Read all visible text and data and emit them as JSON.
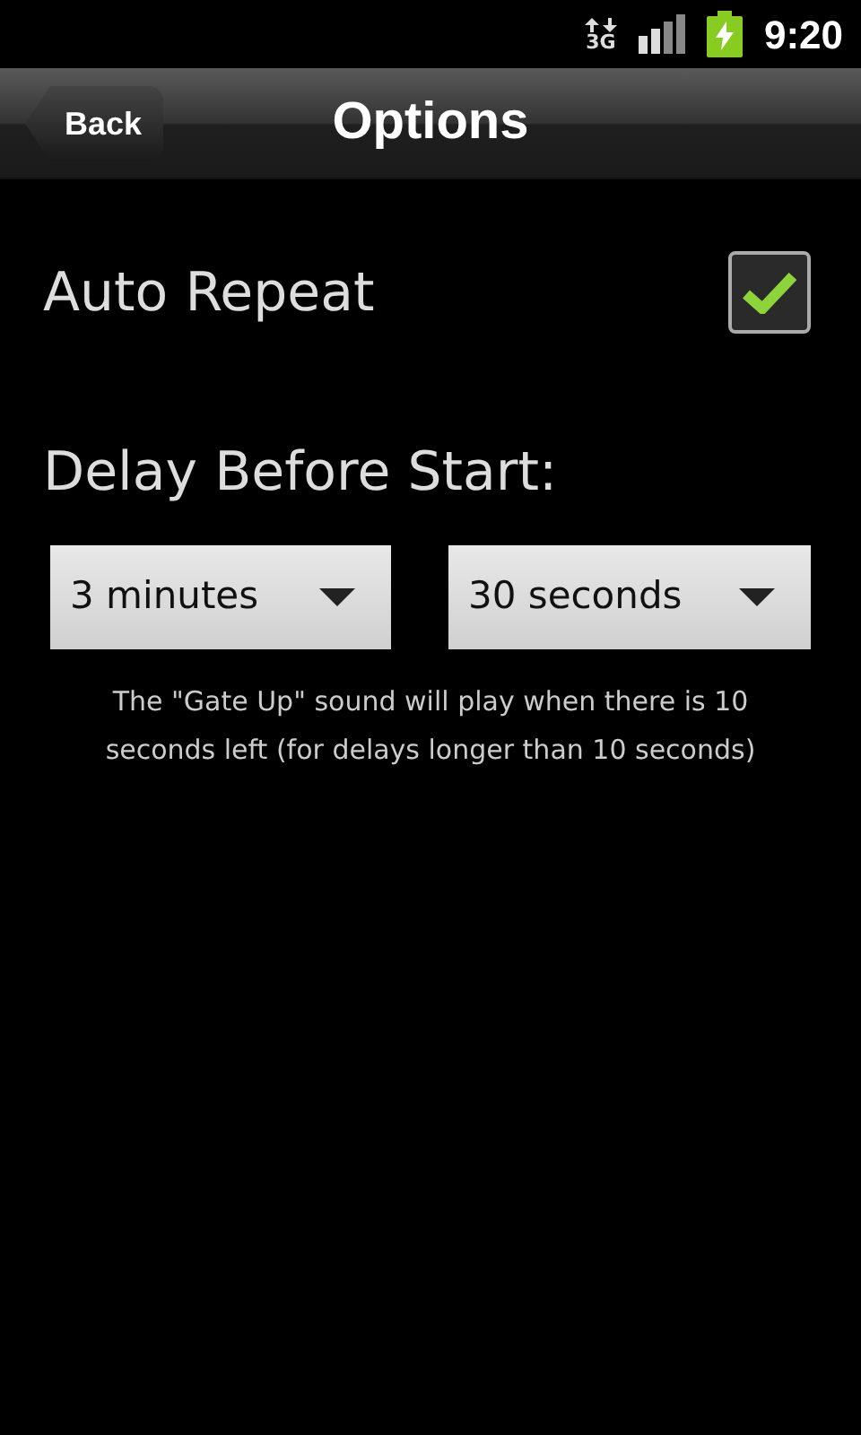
{
  "status_bar": {
    "network": "3G",
    "charging": true,
    "time": "9:20"
  },
  "header": {
    "back": "Back",
    "title": "Options"
  },
  "auto_repeat": {
    "label": "Auto Repeat",
    "checked": true
  },
  "delay": {
    "label": "Delay Before Start:",
    "selects": [
      {
        "value": "3 minutes"
      },
      {
        "value": "30 seconds"
      }
    ],
    "note": "The \"Gate Up\" sound will play when there is 10 seconds left (for delays longer than 10 seconds)"
  }
}
